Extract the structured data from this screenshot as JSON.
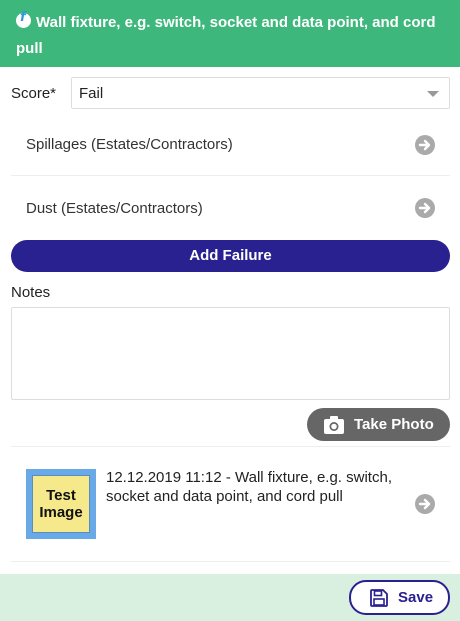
{
  "header": {
    "title": "Wall fixture, e.g. switch, socket and data point, and cord pull",
    "logo_icon": "app-logo-icon"
  },
  "score": {
    "label": "Score*",
    "value": "Fail"
  },
  "failures": [
    {
      "label": "Spillages (Estates/Contractors)"
    },
    {
      "label": "Dust (Estates/Contractors)"
    }
  ],
  "add_failure_label": "Add Failure",
  "notes": {
    "label": "Notes",
    "value": ""
  },
  "take_photo_label": "Take Photo",
  "photo": {
    "thumbnail_text": "Test Image",
    "caption": "12.12.2019 11:12 - Wall fixture, e.g. switch, socket and data point, and cord pull"
  },
  "save_label": "Save",
  "colors": {
    "header": "#3db77b",
    "primary": "#2a2191",
    "footer": "#d9efe0",
    "photo_button": "#666666"
  }
}
